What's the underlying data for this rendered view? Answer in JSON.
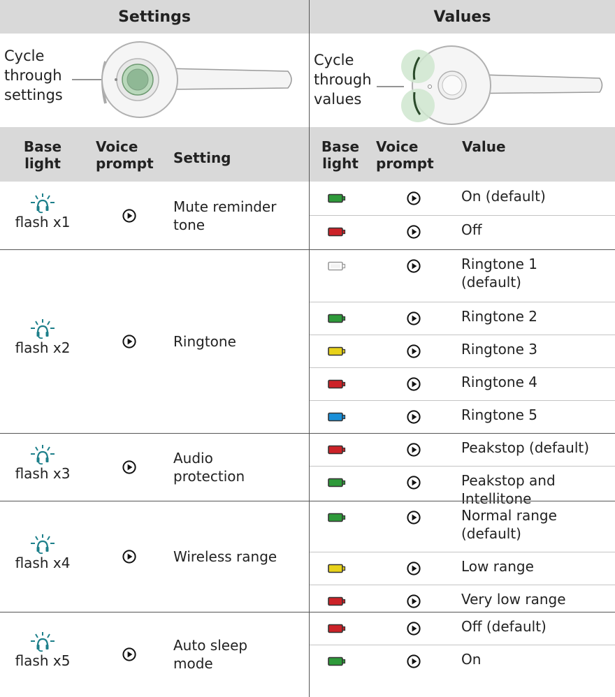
{
  "headers": {
    "settings": "Settings",
    "values": "Values"
  },
  "illustrations": {
    "settings": {
      "label_lines": [
        "Cycle",
        "through",
        "settings"
      ]
    },
    "values": {
      "label_lines": [
        "Cycle",
        "through",
        "values"
      ]
    }
  },
  "columns": {
    "left": {
      "base_light": [
        "Base",
        "light"
      ],
      "voice_prompt": [
        "Voice",
        "prompt"
      ],
      "setting": "Setting"
    },
    "right": {
      "base_light": [
        "Base",
        "light"
      ],
      "voice_prompt": [
        "Voice",
        "prompt"
      ],
      "value": "Value"
    }
  },
  "colors": {
    "green": "#2e9a3a",
    "red": "#cc2228",
    "yellow": "#e8d21a",
    "blue": "#1a8fd8",
    "white": "#ffffff",
    "bulb": "#1d7f8a"
  },
  "icons": {
    "base_light": "headset-light-icon",
    "voice_prompt": "play-icon",
    "value_light": "battery-light-icon"
  },
  "settings": [
    {
      "flash": "flash x1",
      "name": [
        "Mute reminder",
        "tone"
      ],
      "values": [
        {
          "color": "green",
          "label": [
            "On (default)"
          ]
        },
        {
          "color": "red",
          "label": [
            "Off"
          ]
        }
      ]
    },
    {
      "flash": "flash x2",
      "name": [
        "Ringtone"
      ],
      "values": [
        {
          "color": "white",
          "label": [
            "Ringtone 1",
            "(default)"
          ]
        },
        {
          "color": "green",
          "label": [
            "Ringtone 2"
          ]
        },
        {
          "color": "yellow",
          "label": [
            "Ringtone 3"
          ]
        },
        {
          "color": "red",
          "label": [
            "Ringtone 4"
          ]
        },
        {
          "color": "blue",
          "label": [
            "Ringtone 5"
          ]
        }
      ]
    },
    {
      "flash": "flash x3",
      "name": [
        "Audio",
        "protection"
      ],
      "values": [
        {
          "color": "red",
          "label": [
            "Peakstop (default)"
          ]
        },
        {
          "color": "green",
          "label": [
            "Peakstop and",
            "Intellitone"
          ]
        }
      ]
    },
    {
      "flash": "flash x4",
      "name": [
        "Wireless range"
      ],
      "values": [
        {
          "color": "green",
          "label": [
            "Normal range",
            "(default)"
          ]
        },
        {
          "color": "yellow",
          "label": [
            "Low range"
          ]
        },
        {
          "color": "red",
          "label": [
            "Very low range"
          ]
        }
      ]
    },
    {
      "flash": "flash x5",
      "name": [
        "Auto sleep",
        "mode"
      ],
      "values": [
        {
          "color": "red",
          "label": [
            "Off (default)"
          ]
        },
        {
          "color": "green",
          "label": [
            "On"
          ]
        }
      ]
    }
  ]
}
